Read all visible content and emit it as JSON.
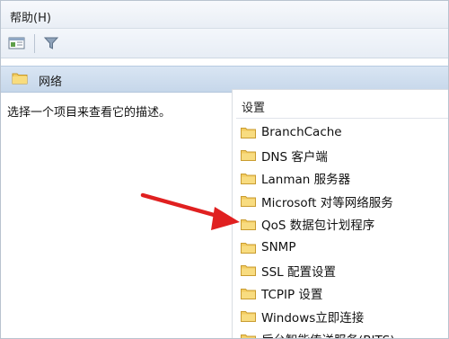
{
  "menubar": {
    "help_label": "帮助(H)"
  },
  "toolbar": {
    "buttons": [
      {
        "icon": "show-hide-console-tree-icon"
      },
      {
        "icon": "filter-icon"
      }
    ]
  },
  "section": {
    "title": "网络",
    "icon": "folder-icon"
  },
  "description": {
    "text": "选择一个项目来查看它的描述。"
  },
  "list": {
    "header": "设置",
    "items": [
      {
        "label": "BranchCache",
        "icon": "folder-icon"
      },
      {
        "label": "DNS 客户端",
        "icon": "folder-icon"
      },
      {
        "label": "Lanman 服务器",
        "icon": "folder-icon"
      },
      {
        "label": "Microsoft 对等网络服务",
        "icon": "folder-icon"
      },
      {
        "label": "QoS 数据包计划程序",
        "icon": "folder-icon",
        "highlighted_by_arrow": true
      },
      {
        "label": "SNMP",
        "icon": "folder-icon"
      },
      {
        "label": "SSL 配置设置",
        "icon": "folder-icon"
      },
      {
        "label": "TCPIP 设置",
        "icon": "folder-icon"
      },
      {
        "label": "Windows立即连接",
        "icon": "folder-icon"
      },
      {
        "label": "后台智能传送服务(BITS)",
        "icon": "folder-icon"
      }
    ]
  },
  "colors": {
    "arrow": "#e02020",
    "header_band": "#c9d9ec",
    "folder": "#f3cd62"
  }
}
